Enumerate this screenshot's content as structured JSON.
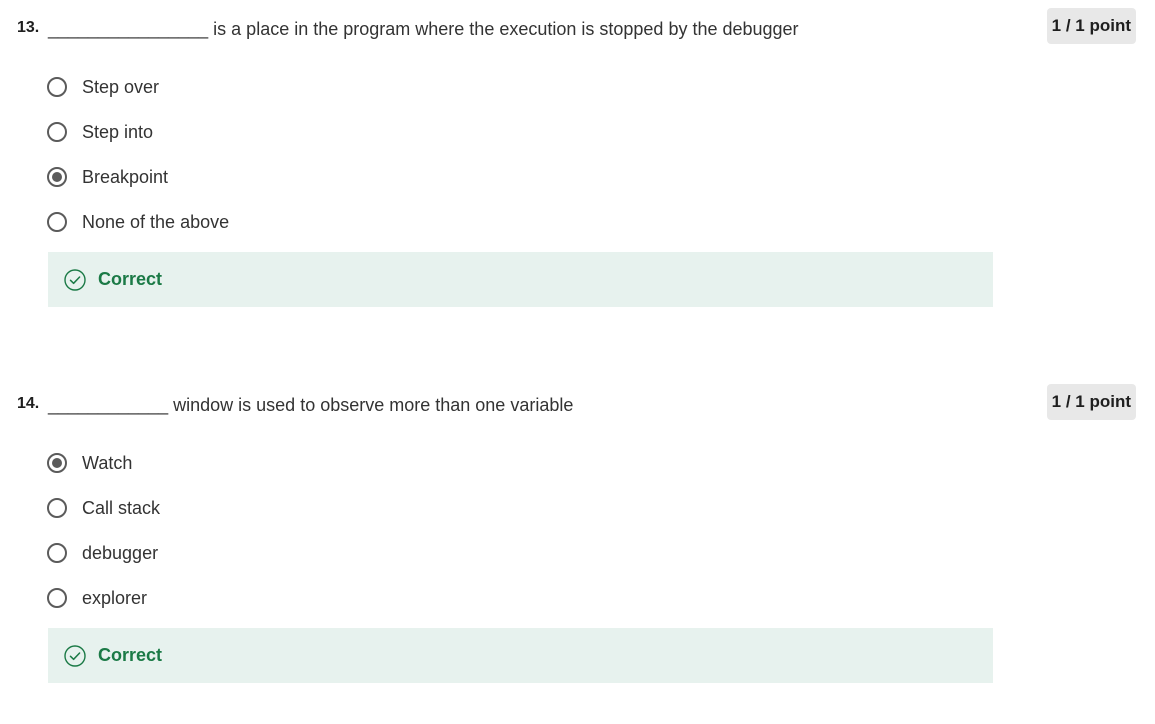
{
  "questions": [
    {
      "number": "13.",
      "text": "________________ is a place in the program where the execution is stopped by the debugger",
      "points": "1 / 1 point",
      "options": [
        {
          "label": "Step over",
          "selected": false
        },
        {
          "label": "Step into",
          "selected": false
        },
        {
          "label": "Breakpoint",
          "selected": true
        },
        {
          "label": "None of the above",
          "selected": false
        }
      ],
      "feedback": {
        "label": "Correct",
        "icon": "check-circle-icon"
      }
    },
    {
      "number": "14.",
      "text": "____________ window is used to observe more than one variable",
      "points": "1 / 1 point",
      "options": [
        {
          "label": "Watch",
          "selected": true
        },
        {
          "label": "Call stack",
          "selected": false
        },
        {
          "label": "debugger",
          "selected": false
        },
        {
          "label": "explorer",
          "selected": false
        }
      ],
      "feedback": {
        "label": "Correct",
        "icon": "check-circle-icon"
      }
    }
  ],
  "colors": {
    "correct_text": "#1b7a46",
    "correct_bg": "#e7f2ee",
    "points_bg": "#e8e8e8",
    "radio": "#5b5b5b"
  }
}
